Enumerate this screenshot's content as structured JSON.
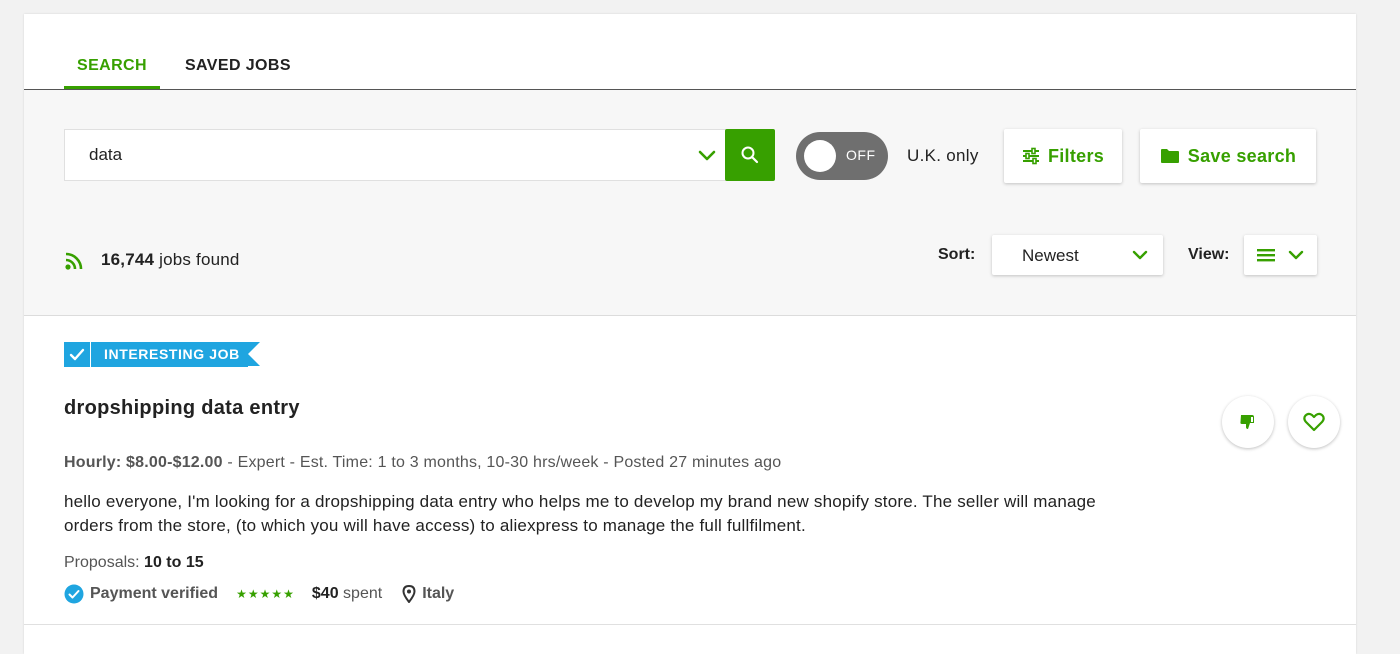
{
  "tabs": [
    {
      "label": "SEARCH",
      "active": true
    },
    {
      "label": "SAVED JOBS",
      "active": false
    }
  ],
  "search": {
    "value": "data",
    "toggle_label": "OFF",
    "region_label": "U.K. only",
    "filters_label": "Filters",
    "save_search_label": "Save search"
  },
  "results": {
    "count": "16,744",
    "suffix": "jobs found",
    "sort_label": "Sort:",
    "sort_value": "Newest",
    "view_label": "View:"
  },
  "job": {
    "badge": "INTERESTING JOB",
    "title": "dropshipping data entry",
    "rate_label": "Hourly: $8.00-$12.00",
    "meta_rest": " - Expert - Est. Time: 1 to 3 months, 10-30 hrs/week - Posted 27 minutes ago",
    "description": "hello everyone, I'm looking for a dropshipping data entry who helps me to develop my brand new shopify store. The seller will manage orders from the store, (to which you will have access) to aliexpress to manage the full fullfilment.",
    "proposals_label": "Proposals: ",
    "proposals_value": "10 to 15",
    "payment_status": "Payment verified",
    "rating_stars": 5,
    "spent_amount": "$40",
    "spent_suffix": " spent",
    "location": "Italy"
  },
  "colors": {
    "accent": "#37a000",
    "badge": "#1fa5e0",
    "toggle_off": "#6f6f6f"
  }
}
